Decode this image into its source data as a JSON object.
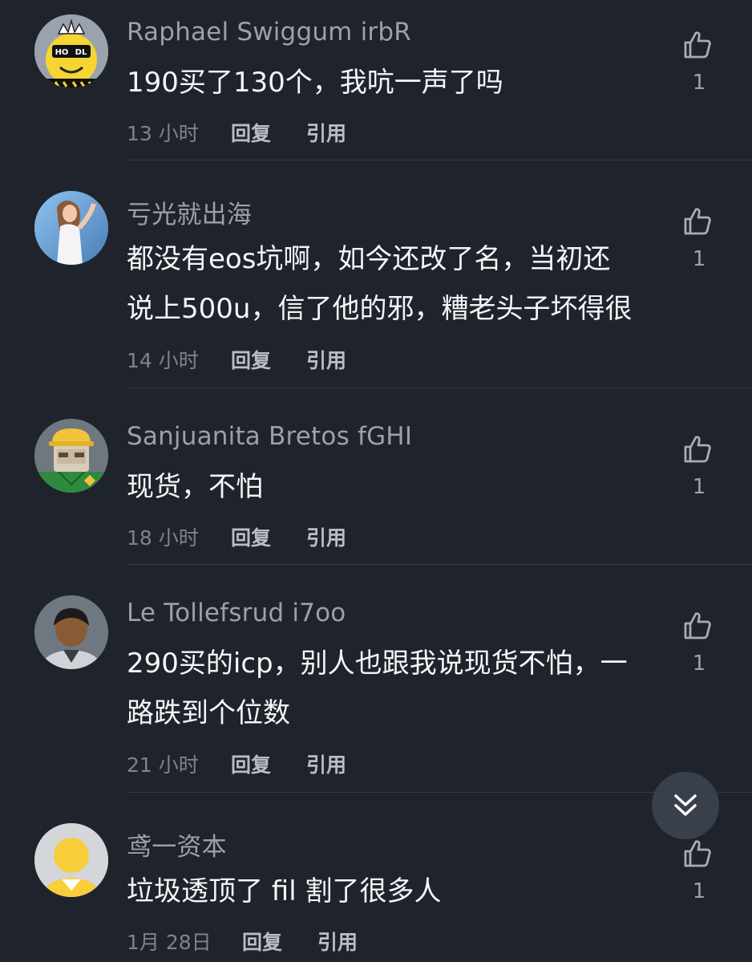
{
  "comments": [
    {
      "author": "Raphael Swiggum irbR",
      "lines": [
        "190买了130个，我吭一声了吗"
      ],
      "time": "13 小时",
      "reply": "回复",
      "quote": "引用",
      "likes": "1",
      "avatar": "hodl-crown-avatar-icon",
      "avatar_text": [
        "HO",
        "DL"
      ]
    },
    {
      "author": "亏光就出海",
      "lines": [
        "都没有eos坑啊，如今还改了名，当初还",
        "说上500u，信了他的邪，糟老头子坏得很"
      ],
      "time": "14 小时",
      "reply": "回复",
      "quote": "引用",
      "likes": "1",
      "avatar": "woman-photo-avatar-icon"
    },
    {
      "author": "Sanjuanita Bretos fGHI",
      "lines": [
        "现货，不怕"
      ],
      "time": "18 小时",
      "reply": "回复",
      "quote": "引用",
      "likes": "1",
      "avatar": "hardhat-worker-avatar-icon"
    },
    {
      "author": "Le Tollefsrud i7oo",
      "lines": [
        "290买的icp，别人也跟我说现货不怕，一",
        "路跌到个位数"
      ],
      "time": "21 小时",
      "reply": "回复",
      "quote": "引用",
      "likes": "1",
      "avatar": "dark-person-avatar-icon"
    },
    {
      "author": "鸢一资本",
      "lines": [
        "垃圾透顶了 fil 割了很多人"
      ],
      "time": "1月 28日",
      "reply": "回复",
      "quote": "引用",
      "likes": "1",
      "avatar": "yellow-person-avatar-icon"
    }
  ],
  "icons": {
    "like": "thumbs-up-icon",
    "scroll": "double-chevron-down-icon"
  },
  "colors": {
    "background": "#1f232b",
    "name": "#9aa1ab",
    "text": "#f4f5f7",
    "muted": "#7d848e"
  }
}
